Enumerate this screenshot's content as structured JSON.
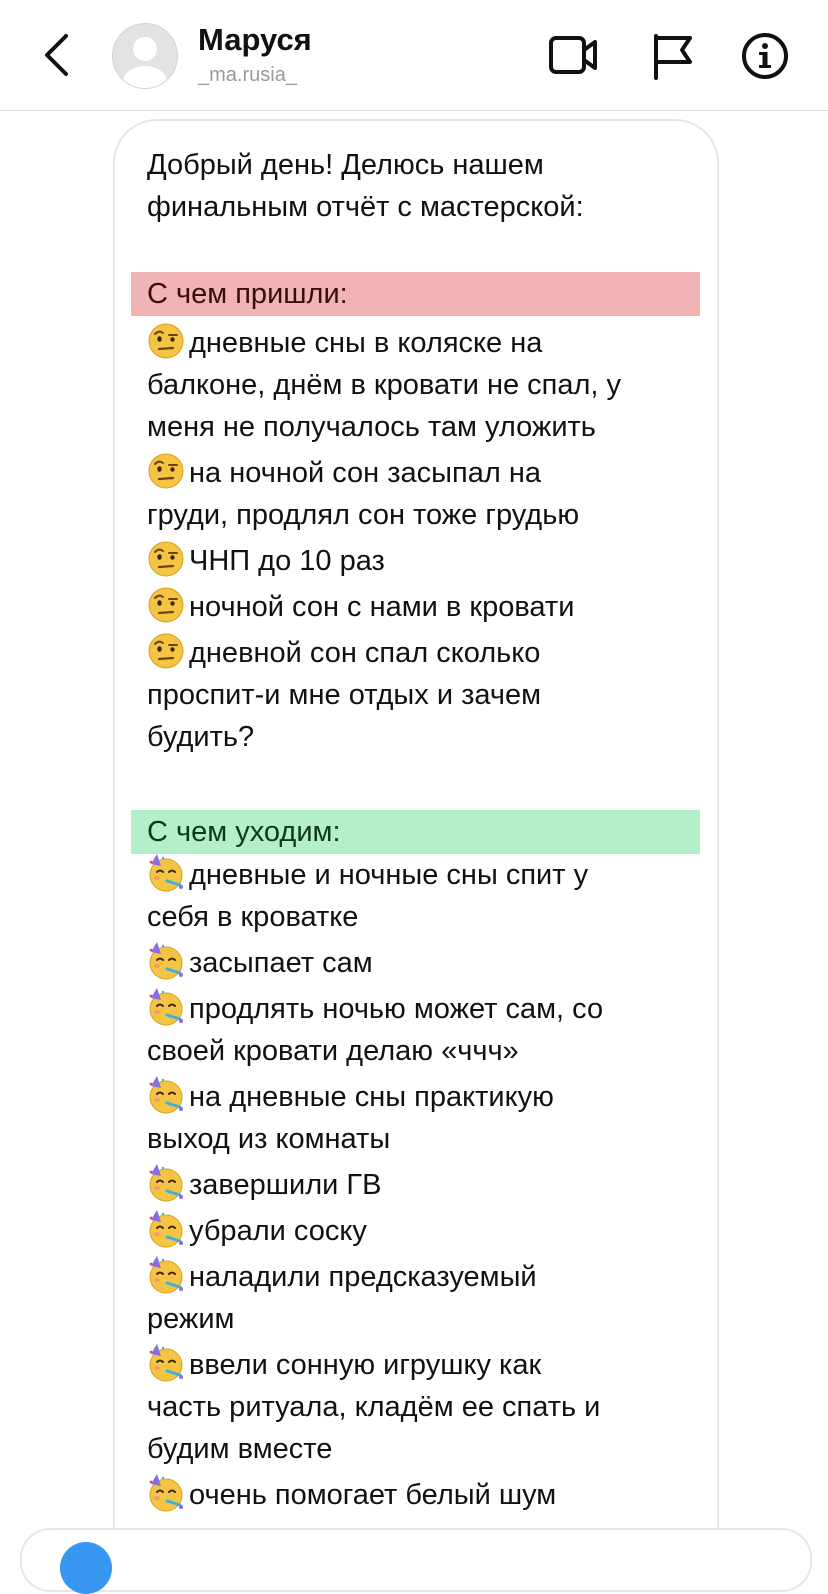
{
  "header": {
    "name": "Маруся",
    "username": "_ma.rusia_",
    "icons": [
      "back-chevron-icon",
      "avatar-placeholder",
      "video-call-icon",
      "flag-icon",
      "info-icon"
    ]
  },
  "message": {
    "intro_line1": "Добрый день! Делюсь нашем",
    "intro_line2": "финальным отчёт с мастерской:",
    "came_header": "С чем пришли:",
    "came_items": [
      "дневные сны в коляске на\nбалконе, днём в кровати не спал, у\nменя не получалось там уложить",
      "на ночной сон засыпал на\nгруди, продлял сон тоже грудью",
      "ЧНП до 10 раз",
      "ночной сон с нами в кровати",
      "дневной сон спал сколько\nпроспит-и мне отдых и зачем\nбудить?"
    ],
    "leave_header": "С чем уходим:",
    "leave_items": [
      "дневные и ночные сны спит у\nсебя в кроватке",
      "засыпает сам",
      "продлять ночью может сам, со\nсвоей кровати делаю «ччч»",
      "на дневные сны практикую\nвыход из комнаты",
      "завершили ГВ",
      "убрали соску",
      "наладили предсказуемый\nрежим",
      "ввели сонную игрушку как\nчасть ритуала, кладём ее спать и\nбудим вместе",
      "очень помогает белый шум"
    ],
    "emoji_came": "face-with-raised-eyebrow-emoji",
    "emoji_leave": "partying-face-emoji"
  },
  "colors": {
    "came_highlight": "#f2b3b4",
    "leave_highlight": "#b3efc9",
    "accent": "#3797f0"
  }
}
